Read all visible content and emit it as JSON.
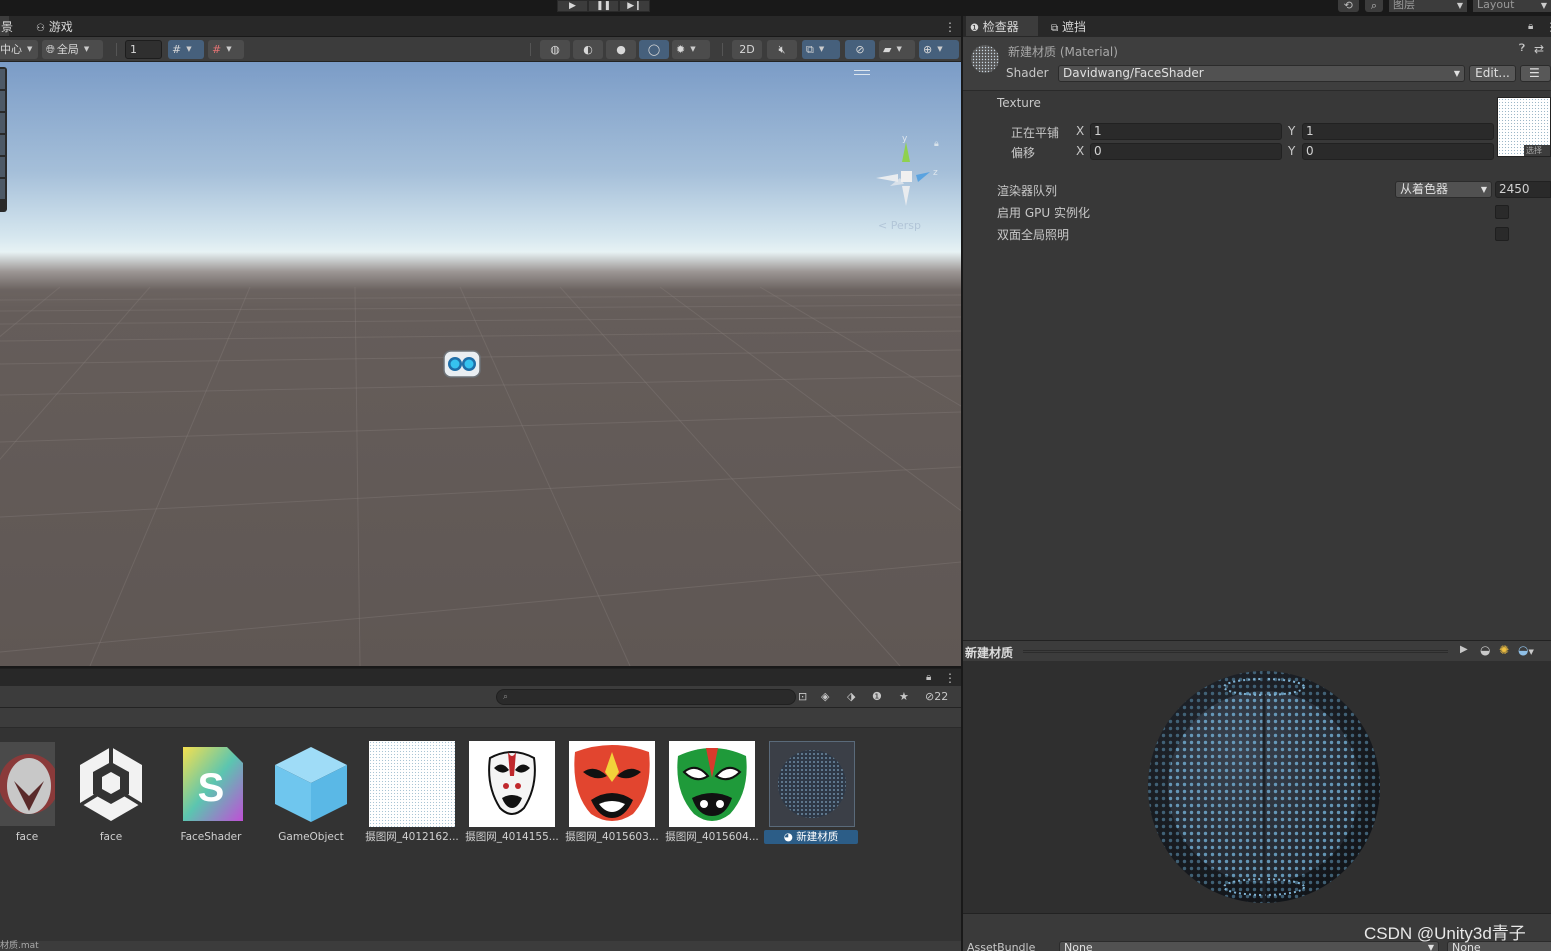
{
  "play_controls": {
    "play": "▶",
    "pause": "❚❚",
    "step": "▶❙"
  },
  "top_right": {
    "layers_label": "图层",
    "layout_label": "Layout"
  },
  "scene": {
    "tabs": [
      {
        "label": "景"
      },
      {
        "label": "游戏"
      }
    ],
    "toolbar": {
      "pivot": "中心",
      "space": "全局",
      "snap_value": "1",
      "two_d": "2D"
    },
    "view": {
      "projection": "Persp",
      "gizmo_y": "y",
      "gizmo_z": "z"
    }
  },
  "project": {
    "hidden_count": "22",
    "assets": [
      {
        "name": "face",
        "type": "model",
        "selected": false
      },
      {
        "name": "face",
        "type": "unity-prefab",
        "selected": false
      },
      {
        "name": "FaceShader",
        "type": "shader",
        "selected": false
      },
      {
        "name": "GameObject",
        "type": "prefab",
        "selected": false
      },
      {
        "name": "摄图网_4012162...",
        "type": "texture-pattern",
        "selected": false
      },
      {
        "name": "摄图网_4014155...",
        "type": "texture-mask-white",
        "selected": false
      },
      {
        "name": "摄图网_4015603...",
        "type": "texture-mask-red",
        "selected": false
      },
      {
        "name": "摄图网_4015604...",
        "type": "texture-mask-green",
        "selected": false
      },
      {
        "name": "新建材质",
        "type": "material",
        "selected": true
      }
    ],
    "status_left": "材质.mat"
  },
  "inspector": {
    "tabs": [
      {
        "label": "检查器"
      },
      {
        "label": "遮挡"
      }
    ],
    "title": "新建材质 (Material)",
    "shader_label": "Shader",
    "shader_value": "Davidwang/FaceShader",
    "edit_button": "Edit...",
    "texture_label": "Texture",
    "tiling": {
      "label": "正在平铺",
      "x_label": "X",
      "x": "1",
      "y_label": "Y",
      "y": "1"
    },
    "offset": {
      "label": "偏移",
      "x_label": "X",
      "x": "0",
      "y_label": "Y",
      "y": "0"
    },
    "select_label": "选择",
    "render_queue": {
      "label": "渲染器队列",
      "mode": "从着色器",
      "value": "2450"
    },
    "gpu_instancing": {
      "label": "启用 GPU 实例化",
      "checked": false
    },
    "double_sided_gi": {
      "label": "双面全局照明",
      "checked": false
    },
    "preview_title": "新建材质",
    "assetbundle_label": "AssetBundle",
    "assetbundle_value": "None",
    "assetbundle_variant": "None"
  },
  "watermark": "CSDN @Unity3d青子",
  "colors": {
    "accent": "#2c5d87",
    "panel": "#383838",
    "sky_top": "#7b9cc7",
    "ground": "#605855"
  }
}
